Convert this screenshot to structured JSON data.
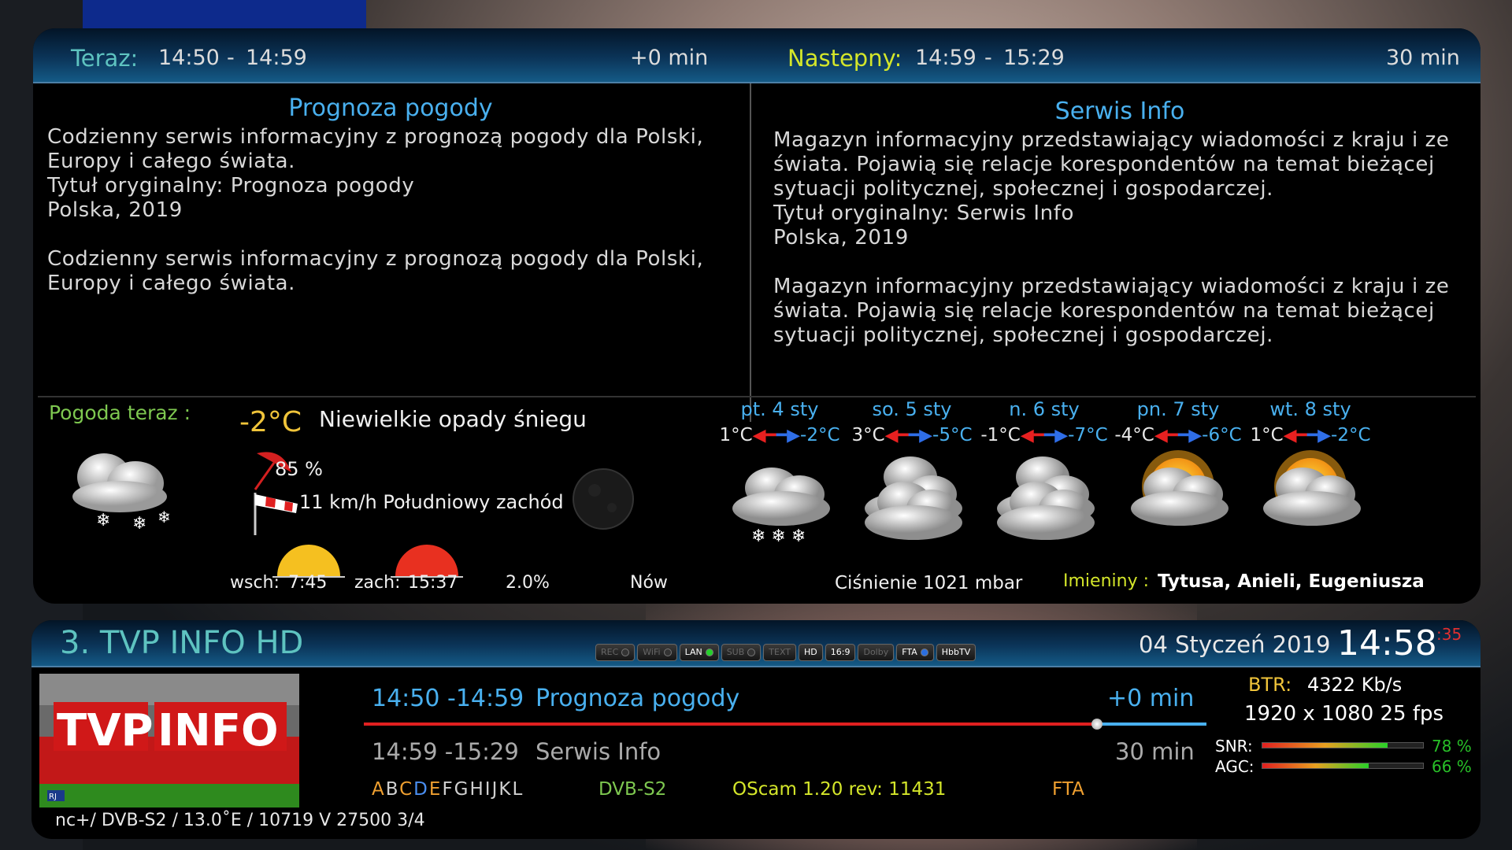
{
  "now_next": {
    "now_label": "Teraz:",
    "now_start": "14:50",
    "now_sep": "-",
    "now_end": "14:59",
    "now_offset": "+0  min",
    "next_label": "Nastepny:",
    "next_start": "14:59",
    "next_sep": "-",
    "next_end": "15:29",
    "next_duration": "30  min"
  },
  "descriptions": {
    "left": {
      "title": "Prognoza pogody",
      "text": "Codzienny serwis informacyjny z prognozą pogody dla Polski,\nEuropy i całego świata.\nTytuł oryginalny: Prognoza pogody\nPolska, 2019\n\nCodzienny serwis informacyjny z prognozą pogody dla Polski,\nEuropy i całego świata."
    },
    "right": {
      "title": "Serwis Info",
      "text": "Magazyn informacyjny przedstawiający wiadomości z kraju i ze\nświata. Pojawią się relacje korespondentów na temat bieżącej\nsytuacji politycznej, społecznej i gospodarczej.\nTytuł oryginalny: Serwis Info\nPolska, 2019\n\nMagazyn informacyjny przedstawiający wiadomości z kraju i ze\nświata. Pojawią się relacje korespondentów na temat bieżącej\nsytuacji politycznej, społecznej i gospodarczej."
    }
  },
  "weather": {
    "now_label": "Pogoda teraz :",
    "temp": "-2°C",
    "condition": "Niewielkie opady śniegu",
    "humidity": "85  %",
    "wind": "11 km/h Południowy zachód",
    "sunrise_label": "wsch:",
    "sunrise": "7:45",
    "sunset_label": "zach:",
    "sunset": "15:37",
    "moon_percent": "2.0%",
    "moon_phase": "Nów",
    "pressure": "Ciśnienie  1021  mbar",
    "namedays_label": "Imieniny :",
    "namedays": "Tytusa, Anieli, Eugeniusza",
    "forecast": [
      {
        "day": "pt. 4 sty",
        "hi": "1°C",
        "lo": "-2°C",
        "icon": "snow-cloud-icon"
      },
      {
        "day": "so. 5 sty",
        "hi": "3°C",
        "lo": "-5°C",
        "icon": "cloud-icon"
      },
      {
        "day": "n. 6 sty",
        "hi": "-1°C",
        "lo": "-7°C",
        "icon": "cloud-icon"
      },
      {
        "day": "pn. 7 sty",
        "hi": "-4°C",
        "lo": "-6°C",
        "icon": "sun-cloud-icon"
      },
      {
        "day": "wt. 8 sty",
        "hi": "1°C",
        "lo": "-2°C",
        "icon": "sun-cloud-icon"
      }
    ]
  },
  "infobar": {
    "channel": "3. TVP INFO HD",
    "date": "04 Styczeń 2019",
    "time": "14:58",
    "seconds": ":35",
    "badges": [
      {
        "label": "REC",
        "active": false
      },
      {
        "label": "WiFi",
        "active": false
      },
      {
        "label": "LAN",
        "active": true
      },
      {
        "label": "SUB",
        "active": false
      },
      {
        "label": "TEXT",
        "active": false
      },
      {
        "label": "HD",
        "active": true
      },
      {
        "label": "16:9",
        "active": true
      },
      {
        "label": "Dolby",
        "active": false
      },
      {
        "label": "FTA",
        "active": true
      },
      {
        "label": "HbbTV",
        "active": true
      }
    ],
    "logo_text_left": "TVP",
    "logo_text_right": "INFO",
    "logo_corner": "RJ",
    "now_time": "14:50 -14:59",
    "now_title": "Prognoza pogody",
    "now_offset": "+0  min",
    "progress": 0.87,
    "next_time": "14:59  -15:29",
    "next_title": "Serwis  Info",
    "next_duration": "30  min",
    "cas_letters": [
      "A",
      "B",
      "C",
      "D",
      "E",
      "F",
      "G",
      "H",
      "I",
      "J",
      "K",
      "L"
    ],
    "delivery": "DVB-S2",
    "softcam": "OScam  1.20  rev:  11431",
    "crypt": "FTA",
    "transponder": "nc+/  DVB-S2  /  13.0˚E  /  10719  V  27500  3/4",
    "btr_label": "BTR:",
    "btr_value": "4322 Kb/s",
    "resolution": "1920  x  1080  25  fps",
    "snr_label": "SNR:",
    "snr_value": "78 %",
    "snr": 0.78,
    "agc_label": "AGC:",
    "agc_value": "66 %",
    "agc": 0.66,
    "colors": {
      "accent": "#49b0ef",
      "green": "#7ec850",
      "yellow": "#d4e62a",
      "orange": "#f0a030",
      "red": "#e02020"
    }
  }
}
